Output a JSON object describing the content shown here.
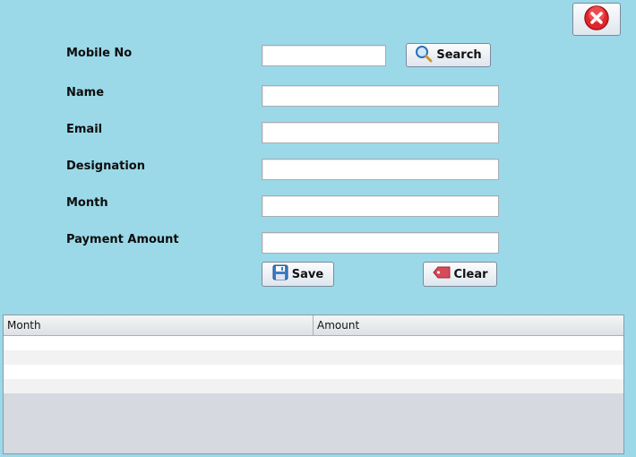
{
  "form": {
    "mobile_label": "Mobile No",
    "name_label": "Name",
    "email_label": "Email",
    "designation_label": "Designation",
    "month_label": "Month",
    "payment_label": "Payment Amount",
    "mobile_value": "",
    "name_value": "",
    "email_value": "",
    "designation_value": "",
    "month_value": "",
    "payment_value": ""
  },
  "buttons": {
    "search_label": "Search",
    "save_label": "Save",
    "clear_label": "Clear"
  },
  "table": {
    "columns": [
      "Month",
      "Amount"
    ],
    "rows": [
      [
        "",
        ""
      ],
      [
        "",
        ""
      ],
      [
        "",
        ""
      ],
      [
        "",
        ""
      ]
    ]
  },
  "icons": {
    "close": "close-icon",
    "search": "magnifier-icon",
    "save": "floppy-icon",
    "clear": "eraser-icon"
  },
  "colors": {
    "background": "#9bd9e9",
    "close_red": "#e0262b"
  }
}
